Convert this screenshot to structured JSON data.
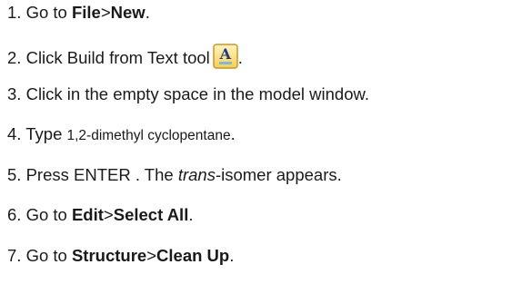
{
  "steps": [
    {
      "number": "1.",
      "parts": [
        "Go to ",
        "File",
        ">",
        "New",
        "."
      ]
    },
    {
      "number": "2.",
      "text": "Click Build from Text tool",
      "icon": "build-from-text-tool-icon",
      "icon_glyph": "A",
      "suffix": "."
    },
    {
      "number": "3.",
      "text": "Click in the empty space in the model window."
    },
    {
      "number": "4.",
      "prefix": "Type ",
      "code": "1,2-dimethyl cyclopentane",
      "suffix": "."
    },
    {
      "number": "5.",
      "prefix": "Press ENTER . The ",
      "italic": "trans",
      "suffix": "-isomer appears."
    },
    {
      "number": "6.",
      "parts": [
        "Go to ",
        "Edit",
        ">",
        "Select All",
        "."
      ]
    },
    {
      "number": "7.",
      "parts": [
        "Go to ",
        "Structure",
        ">",
        "Clean Up",
        "."
      ]
    }
  ],
  "colors": {
    "text": "#1a1a1a",
    "icon_fill_top": "#fff6c2",
    "icon_fill_bottom": "#f7cf4a",
    "icon_border": "#c9962a",
    "icon_glyph": "#1f3a93"
  }
}
